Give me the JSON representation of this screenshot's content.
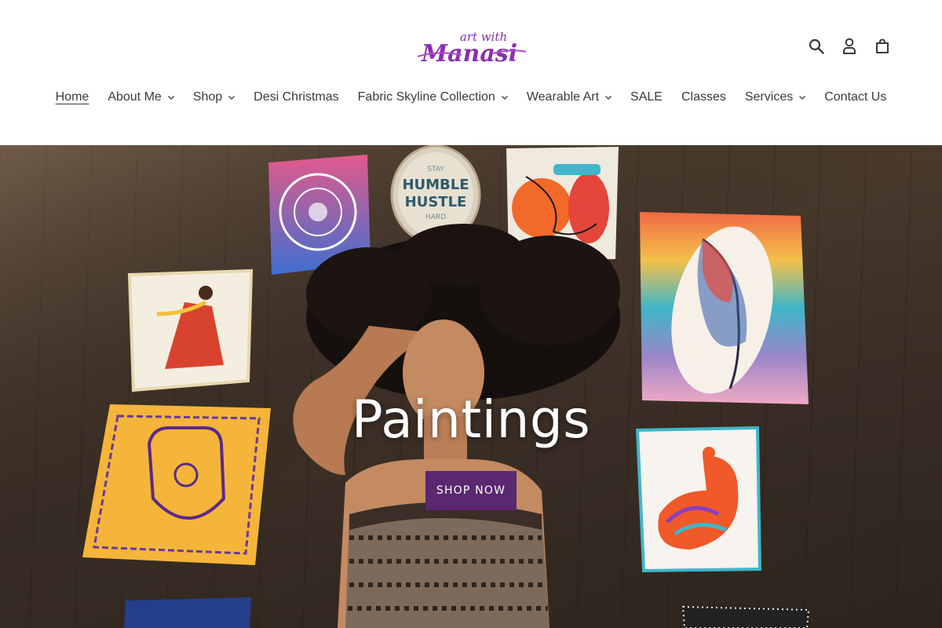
{
  "brand": {
    "logo_text": "art with manasi",
    "logo_line1": "art with",
    "logo_line2": "Manasi"
  },
  "header_icons": [
    {
      "name": "search-icon"
    },
    {
      "name": "account-icon"
    },
    {
      "name": "cart-icon"
    }
  ],
  "nav": {
    "items": [
      {
        "label": "Home",
        "dropdown": false,
        "active": true
      },
      {
        "label": "About Me",
        "dropdown": true
      },
      {
        "label": "Shop",
        "dropdown": true
      },
      {
        "label": "Desi Christmas",
        "dropdown": false
      },
      {
        "label": "Fabric Skyline Collection",
        "dropdown": true
      },
      {
        "label": "Wearable Art",
        "dropdown": true
      },
      {
        "label": "SALE",
        "dropdown": false
      },
      {
        "label": "Classes",
        "dropdown": false
      },
      {
        "label": "Services",
        "dropdown": true
      },
      {
        "label": "Contact Us",
        "dropdown": false
      }
    ]
  },
  "hero": {
    "title": "Paintings",
    "cta_label": "SHOP NOW",
    "image_alt": "Woman lying on a wooden floor surrounded by paintings",
    "painting_text": {
      "line1": "STAY",
      "line2": "HUMBLE",
      "line3": "HUSTLE",
      "line4": "HARD"
    }
  },
  "colors": {
    "brand_purple": "#5a2770",
    "logo_purple": "#8a2fb0",
    "text": "#3a3a3a"
  }
}
